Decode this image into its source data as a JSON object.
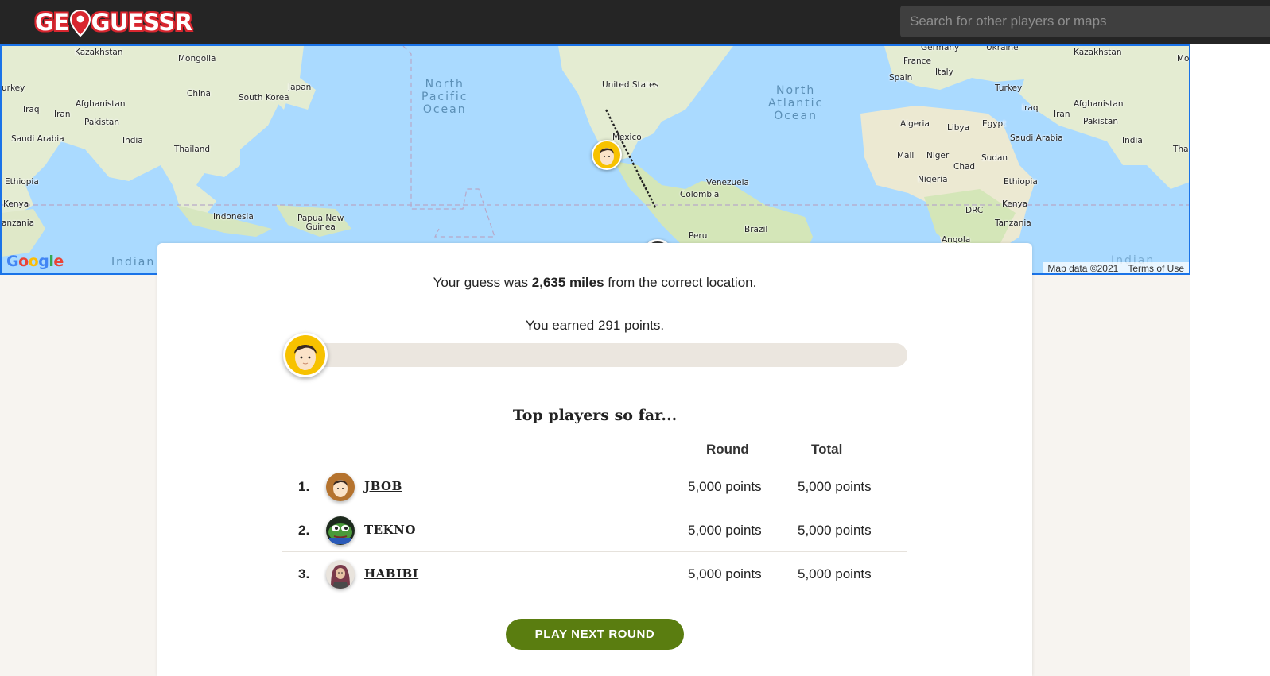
{
  "header": {
    "logo_text_left": "GE",
    "logo_text_right": "GUESSR",
    "search_placeholder": "Search for other players or maps"
  },
  "map": {
    "labels": [
      {
        "text": "Kazakhstan"
      },
      {
        "text": "Mongolia"
      },
      {
        "text": "urkey"
      },
      {
        "text": "China"
      },
      {
        "text": "Japan"
      },
      {
        "text": "South Korea"
      },
      {
        "text": "Iraq"
      },
      {
        "text": "Iran"
      },
      {
        "text": "Afghanistan"
      },
      {
        "text": "Pakistan"
      },
      {
        "text": "Saudi Arabia"
      },
      {
        "text": "India"
      },
      {
        "text": "Thailand"
      },
      {
        "text": "Ethiopia"
      },
      {
        "text": "Kenya"
      },
      {
        "text": "anzania"
      },
      {
        "text": "Indonesia"
      },
      {
        "text": "Papua New\nGuinea"
      },
      {
        "text": "United States"
      },
      {
        "text": "Mexico"
      },
      {
        "text": "Venezuela"
      },
      {
        "text": "Colombia"
      },
      {
        "text": "Peru"
      },
      {
        "text": "Brazil"
      },
      {
        "text": "France"
      },
      {
        "text": "Spain"
      },
      {
        "text": "Italy"
      },
      {
        "text": "Germany"
      },
      {
        "text": "Ukraine"
      },
      {
        "text": "Algeria"
      },
      {
        "text": "Libya"
      },
      {
        "text": "Egypt"
      },
      {
        "text": "Mali"
      },
      {
        "text": "Niger"
      },
      {
        "text": "Chad"
      },
      {
        "text": "Sudan"
      },
      {
        "text": "Nigeria"
      },
      {
        "text": "DRC"
      },
      {
        "text": "Angola"
      },
      {
        "text": "Turkey"
      },
      {
        "text": "Iraq"
      },
      {
        "text": "Iran"
      },
      {
        "text": "Afghanistan"
      },
      {
        "text": "Pakistan"
      },
      {
        "text": "Saudi Arabia"
      },
      {
        "text": "India"
      },
      {
        "text": "Tha"
      },
      {
        "text": "Ethiopia"
      },
      {
        "text": "Kenya"
      },
      {
        "text": "Tanzania"
      },
      {
        "text": "Kazakhstan"
      },
      {
        "text": "Mo"
      }
    ],
    "oceans": [
      "North\nPacific\nOcean",
      "North\nAtlantic\nOcean",
      "Indian",
      "Indian"
    ],
    "google": "Google",
    "footer": [
      "Map data ©2021",
      "Terms of Use"
    ]
  },
  "result": {
    "distance_prefix": "Your guess was ",
    "distance_value": "2,635 miles",
    "distance_suffix": " from the correct location.",
    "earned_text": "You earned 291 points.",
    "score_fraction": 0.0582
  },
  "leaderboard": {
    "title": "Top players so far...",
    "col_round": "Round",
    "col_total": "Total",
    "rows": [
      {
        "rank": "1.",
        "name": "JBOB",
        "round": "5,000 points",
        "total": "5,000 points",
        "avatar_icon": "face-avatar-icon"
      },
      {
        "rank": "2.",
        "name": "TEKNO",
        "round": "5,000 points",
        "total": "5,000 points",
        "avatar_icon": "frog-avatar-icon"
      },
      {
        "rank": "3.",
        "name": "HABIBI",
        "round": "5,000 points",
        "total": "5,000 points",
        "avatar_icon": "hijab-avatar-icon"
      }
    ]
  },
  "actions": {
    "next_round_label": "PLAY NEXT ROUND"
  },
  "colors": {
    "header_bg": "#252525",
    "logo_red": "#d8262f",
    "accent_yellow": "#f7c200",
    "button_green": "#5a7d10",
    "ocean": "#aadaff",
    "land": "#e8efdc"
  }
}
